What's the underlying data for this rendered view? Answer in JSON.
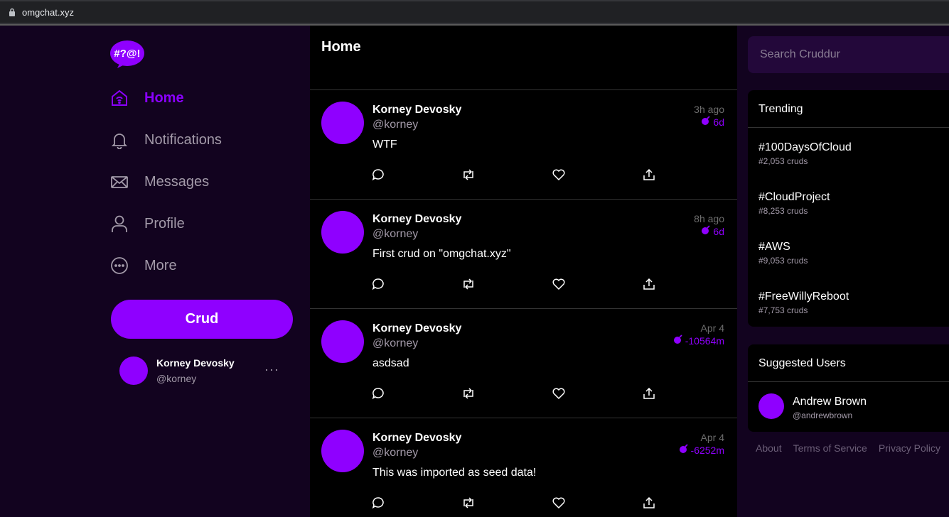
{
  "browser": {
    "url": "omgchat.xyz"
  },
  "logo": {
    "text": "#?@!"
  },
  "nav": {
    "items": [
      {
        "label": "Home",
        "icon": "home-icon",
        "active": true
      },
      {
        "label": "Notifications",
        "icon": "bell-icon"
      },
      {
        "label": "Messages",
        "icon": "mail-icon"
      },
      {
        "label": "Profile",
        "icon": "user-icon"
      },
      {
        "label": "More",
        "icon": "more-circle-icon"
      }
    ],
    "crud_button": "Crud"
  },
  "profile": {
    "name": "Korney Devosky",
    "handle": "@korney",
    "menu": "···"
  },
  "feed": {
    "title": "Home",
    "posts": [
      {
        "name": "Korney Devosky",
        "handle": "@korney",
        "message": "WTF",
        "time": "3h ago",
        "expiry": "6d"
      },
      {
        "name": "Korney Devosky",
        "handle": "@korney",
        "message": "First crud on \"omgchat.xyz\"",
        "time": "8h ago",
        "expiry": "6d"
      },
      {
        "name": "Korney Devosky",
        "handle": "@korney",
        "message": "asdsad",
        "time": "Apr 4",
        "expiry": "-10564m"
      },
      {
        "name": "Korney Devosky",
        "handle": "@korney",
        "message": "This was imported as seed data!",
        "time": "Apr 4",
        "expiry": "-6252m"
      }
    ]
  },
  "search": {
    "placeholder": "Search Cruddur"
  },
  "trending": {
    "title": "Trending",
    "items": [
      {
        "tag": "#100DaysOfCloud",
        "count": "#2,053 cruds"
      },
      {
        "tag": "#CloudProject",
        "count": "#8,253 cruds"
      },
      {
        "tag": "#AWS",
        "count": "#9,053 cruds"
      },
      {
        "tag": "#FreeWillyReboot",
        "count": "#7,753 cruds"
      }
    ]
  },
  "suggested": {
    "title": "Suggested Users",
    "users": [
      {
        "name": "Andrew Brown",
        "handle": "@andrewbrown"
      }
    ]
  },
  "footer": {
    "about": "About",
    "terms": "Terms of Service",
    "privacy": "Privacy Policy"
  },
  "colors": {
    "accent": "#8f00ff",
    "background": "#12031f",
    "feed": "#000000"
  }
}
